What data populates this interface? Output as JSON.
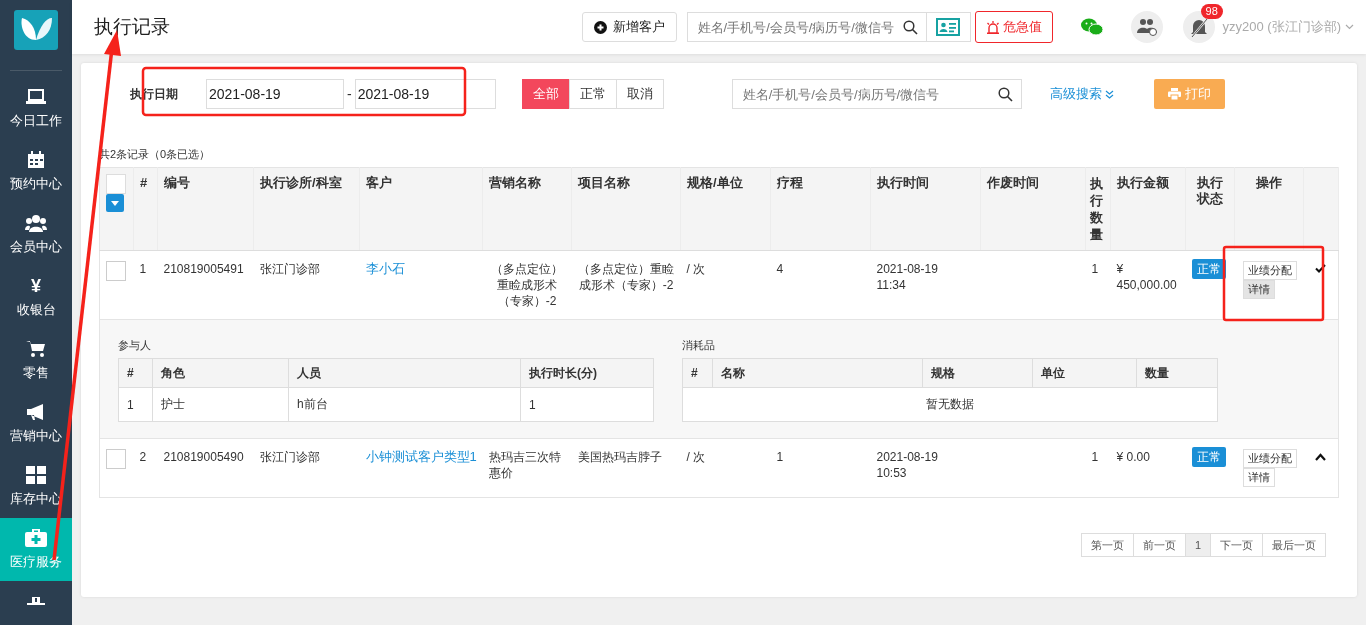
{
  "sidebar": {
    "items": [
      {
        "label": "今日工作",
        "selected": false
      },
      {
        "label": "预约中心",
        "selected": false
      },
      {
        "label": "会员中心",
        "selected": false
      },
      {
        "label": "收银台",
        "icon_text": "¥",
        "selected": false
      },
      {
        "label": "零售",
        "selected": false
      },
      {
        "label": "营销中心",
        "selected": false
      },
      {
        "label": "库存中心",
        "selected": false
      },
      {
        "label": "医疗服务",
        "selected": true
      }
    ]
  },
  "header": {
    "title": "执行记录",
    "new_customer": "新增客户",
    "search_placeholder": "姓名/手机号/会员号/病历号/微信号",
    "alert_button": "危急值",
    "notification_count": "98",
    "user": "yzy200 (张江门诊部)"
  },
  "filters": {
    "date_label": "执行日期",
    "date_from": "2021-08-19",
    "date_separator": "-",
    "date_to": "2021-08-19",
    "status_tabs": [
      {
        "label": "全部",
        "selected": true
      },
      {
        "label": "正常",
        "selected": false
      },
      {
        "label": "取消",
        "selected": false
      }
    ],
    "search_placeholder": "姓名/手机号/会员号/病历号/微信号",
    "advanced_search": "高级搜索",
    "print": "打印"
  },
  "summary": "共2条记录（0条已选）",
  "table": {
    "header_checked": false,
    "columns": [
      "#",
      "编号",
      "执行诊所/科室",
      "客户",
      "营销名称",
      "项目名称",
      "规格/单位",
      "疗程",
      "执行时间",
      "作废时间",
      "执行数量",
      "执行金额",
      "执行状态",
      "操作"
    ],
    "rows": [
      {
        "checked": false,
        "expanded": true,
        "cells": [
          "1",
          "210819005491",
          "张江门诊部",
          "李小石",
          "（多点定位）重睑成形术（专家）-2",
          "（多点定位）重睑成形术（专家）-2",
          "/ 次",
          "4",
          "2021-08-19 11:34",
          "",
          "1",
          "¥ 450,000.00"
        ],
        "status": "正常",
        "actions": [
          "业绩分配",
          "详情"
        ],
        "detail": {
          "participants": {
            "title": "参与人",
            "columns": [
              "#",
              "角色",
              "人员",
              "执行时长(分)"
            ],
            "rows": [
              [
                "1",
                "护士",
                "h前台",
                "1"
              ]
            ]
          },
          "consumables": {
            "title": "消耗品",
            "columns": [
              "#",
              "名称",
              "规格",
              "单位",
              "数量"
            ],
            "empty_text": "暂无数据"
          }
        }
      },
      {
        "checked": false,
        "expanded": false,
        "cells": [
          "2",
          "210819005490",
          "张江门诊部",
          "小钟测试客户类型1",
          "热玛吉三次特惠价",
          "美国热玛吉脖子",
          "/ 次",
          "1",
          "2021-08-19 10:53",
          "",
          "1",
          "¥ 0.00"
        ],
        "status": "正常",
        "actions": [
          "业绩分配",
          "详情"
        ]
      }
    ]
  },
  "pagination": [
    {
      "label": "第一页",
      "selected": false
    },
    {
      "label": "前一页",
      "selected": false
    },
    {
      "label": "1",
      "selected": true
    },
    {
      "label": "下一页",
      "selected": false
    },
    {
      "label": "最后一页",
      "selected": false
    }
  ]
}
